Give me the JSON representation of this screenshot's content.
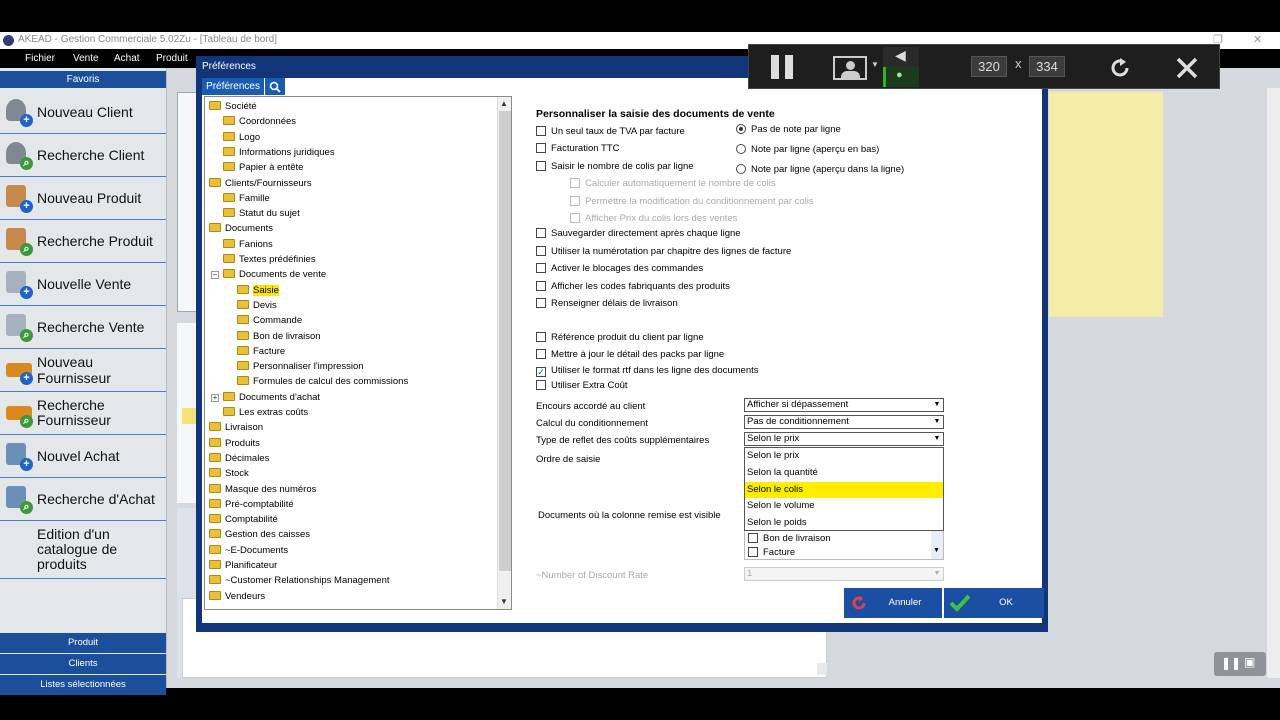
{
  "window": {
    "title": "AKEAD - Gestion Commerciale 5.02Zu - [Tableau de bord]"
  },
  "menu": [
    "Fichier",
    "Vente",
    "Achat",
    "Produit"
  ],
  "sidebar": {
    "header": "Favoris",
    "items": [
      {
        "label": "Nouveau Client",
        "icon": "new-client-icon"
      },
      {
        "label": "Recherche Client",
        "icon": "search-client-icon"
      },
      {
        "label": "Nouveau Produit",
        "icon": "new-product-icon"
      },
      {
        "label": "Recherche Produit",
        "icon": "search-product-icon"
      },
      {
        "label": "Nouvelle Vente",
        "icon": "new-sale-icon"
      },
      {
        "label": "Recherche Vente",
        "icon": "search-sale-icon"
      },
      {
        "label": "Nouveau Fournisseur",
        "icon": "new-supplier-icon"
      },
      {
        "label": "Recherche Fournisseur",
        "icon": "search-supplier-icon"
      },
      {
        "label": "Nouvel Achat",
        "icon": "new-purchase-icon"
      },
      {
        "label": "Recherche d'Achat",
        "icon": "search-purchase-icon"
      },
      {
        "label": "Edition d'un catalogue de produits",
        "icon": ""
      }
    ],
    "bottom_tabs": [
      "Produit",
      "Clients",
      "Listes sélectionnées"
    ]
  },
  "dialog": {
    "title": "Préférences",
    "tab": "Préférences",
    "tree": [
      {
        "label": "Société",
        "level": 0
      },
      {
        "label": "Coordonnées",
        "level": 1
      },
      {
        "label": "Logo",
        "level": 1
      },
      {
        "label": "Informations juridiques",
        "level": 1
      },
      {
        "label": "Papier à entête",
        "level": 1
      },
      {
        "label": "Clients/Fournisseurs",
        "level": 0
      },
      {
        "label": "Famille",
        "level": 1
      },
      {
        "label": "Statut du sujet",
        "level": 1
      },
      {
        "label": "Documents",
        "level": 0
      },
      {
        "label": "Fanions",
        "level": 1
      },
      {
        "label": "Textes prédéfinies",
        "level": 1
      },
      {
        "label": "Documents de vente",
        "level": 1,
        "expand": "−"
      },
      {
        "label": "Saisie",
        "level": 2,
        "selected": true
      },
      {
        "label": "Devis",
        "level": 2
      },
      {
        "label": "Commande",
        "level": 2
      },
      {
        "label": "Bon de livraison",
        "level": 2
      },
      {
        "label": "Facture",
        "level": 2
      },
      {
        "label": "Personnaliser l'impression",
        "level": 2
      },
      {
        "label": "Formules de calcul des commissions",
        "level": 2
      },
      {
        "label": "Documents d'achat",
        "level": 1,
        "expand": "+"
      },
      {
        "label": "Les extras coûts",
        "level": 1
      },
      {
        "label": "Livraison",
        "level": 0
      },
      {
        "label": "Produits",
        "level": 0
      },
      {
        "label": "Décimales",
        "level": 0
      },
      {
        "label": "Stock",
        "level": 0
      },
      {
        "label": "Masque des numéros",
        "level": 0
      },
      {
        "label": "Pré-comptabilité",
        "level": 0
      },
      {
        "label": "Comptabilité",
        "level": 0
      },
      {
        "label": "Gestion des caisses",
        "level": 0
      },
      {
        "label": "~E-Documents",
        "level": 0
      },
      {
        "label": "Planificateur",
        "level": 0
      },
      {
        "label": "~Customer Relationships Management",
        "level": 0
      },
      {
        "label": "Vendeurs",
        "level": 0
      }
    ],
    "section_title": "Personnaliser la saisie des documents de vente",
    "checkboxes_left": [
      {
        "label": "Un seul taux de TVA par facture",
        "checked": false,
        "disabled": false,
        "indent": 0
      },
      {
        "label": "Facturation TTC",
        "checked": false,
        "disabled": false,
        "indent": 0
      },
      {
        "label": "Saisir le nombre de colis par ligne",
        "checked": false,
        "disabled": false,
        "indent": 0
      },
      {
        "label": "Calculer automatiquement le nombre de colis",
        "checked": false,
        "disabled": true,
        "indent": 1
      },
      {
        "label": "Permettre la modification du conditionnement par colis",
        "checked": false,
        "disabled": true,
        "indent": 1
      },
      {
        "label": "Afficher Prix du colis lors des ventes",
        "checked": false,
        "disabled": true,
        "indent": 1
      },
      {
        "label": "Sauvegarder directement après chaque ligne",
        "checked": false,
        "disabled": false,
        "indent": 0
      },
      {
        "label": "Utiliser la numérotation par chapitre des lignes de facture",
        "checked": false,
        "disabled": false,
        "indent": 0
      },
      {
        "label": "Activer le blocages des commandes",
        "checked": false,
        "disabled": false,
        "indent": 0
      },
      {
        "label": "Afficher les codes fabriquants des produits",
        "checked": false,
        "disabled": false,
        "indent": 0
      },
      {
        "label": "Renseigner délais de livraison",
        "checked": false,
        "disabled": false,
        "indent": 0
      },
      {
        "label": "Référence produit du client par ligne",
        "checked": false,
        "disabled": false,
        "indent": 0
      },
      {
        "label": "Mettre à jour le détail des packs par ligne",
        "checked": false,
        "disabled": false,
        "indent": 0
      },
      {
        "label": "Utiliser le format rtf dans les ligne des documents",
        "checked": true,
        "disabled": false,
        "indent": 0
      },
      {
        "label": "Utiliser Extra Coût",
        "checked": false,
        "disabled": false,
        "indent": 0
      }
    ],
    "radios": [
      {
        "label": "Pas de note par ligne",
        "checked": true
      },
      {
        "label": "Note par ligne (aperçu en bas)",
        "checked": false
      },
      {
        "label": "Note par ligne (aperçu dans la ligne)",
        "checked": false
      }
    ],
    "fields": [
      {
        "label": "Encours accordé au client",
        "value": "Afficher si dépassement"
      },
      {
        "label": "Calcul du conditionnement",
        "value": "Pas de conditionnement"
      },
      {
        "label": "Type de reflet des coûts supplémentaires",
        "value": "Selon le prix"
      }
    ],
    "ordre_label": "Ordre de saisie",
    "dropdown_options": [
      "Selon le prix",
      "Selon la quantité",
      "Selon le colis",
      "Selon le volume",
      "Selon le poids"
    ],
    "dropdown_highlight": 2,
    "docs_label": "Documents où la colonne remise est visible",
    "docs_items": [
      {
        "label": "Bon de livraison",
        "checked": false
      },
      {
        "label": "Facture",
        "checked": false
      }
    ],
    "discount_label": "~Number of Discount Rate",
    "discount_value": "1",
    "cancel": "Annuler",
    "ok": "OK"
  },
  "recorder": {
    "width": "320",
    "height": "334",
    "x": "x"
  },
  "colors": {
    "accent": "#1b4f9c",
    "highlight": "#ffed00",
    "dialog": "#12357a"
  }
}
